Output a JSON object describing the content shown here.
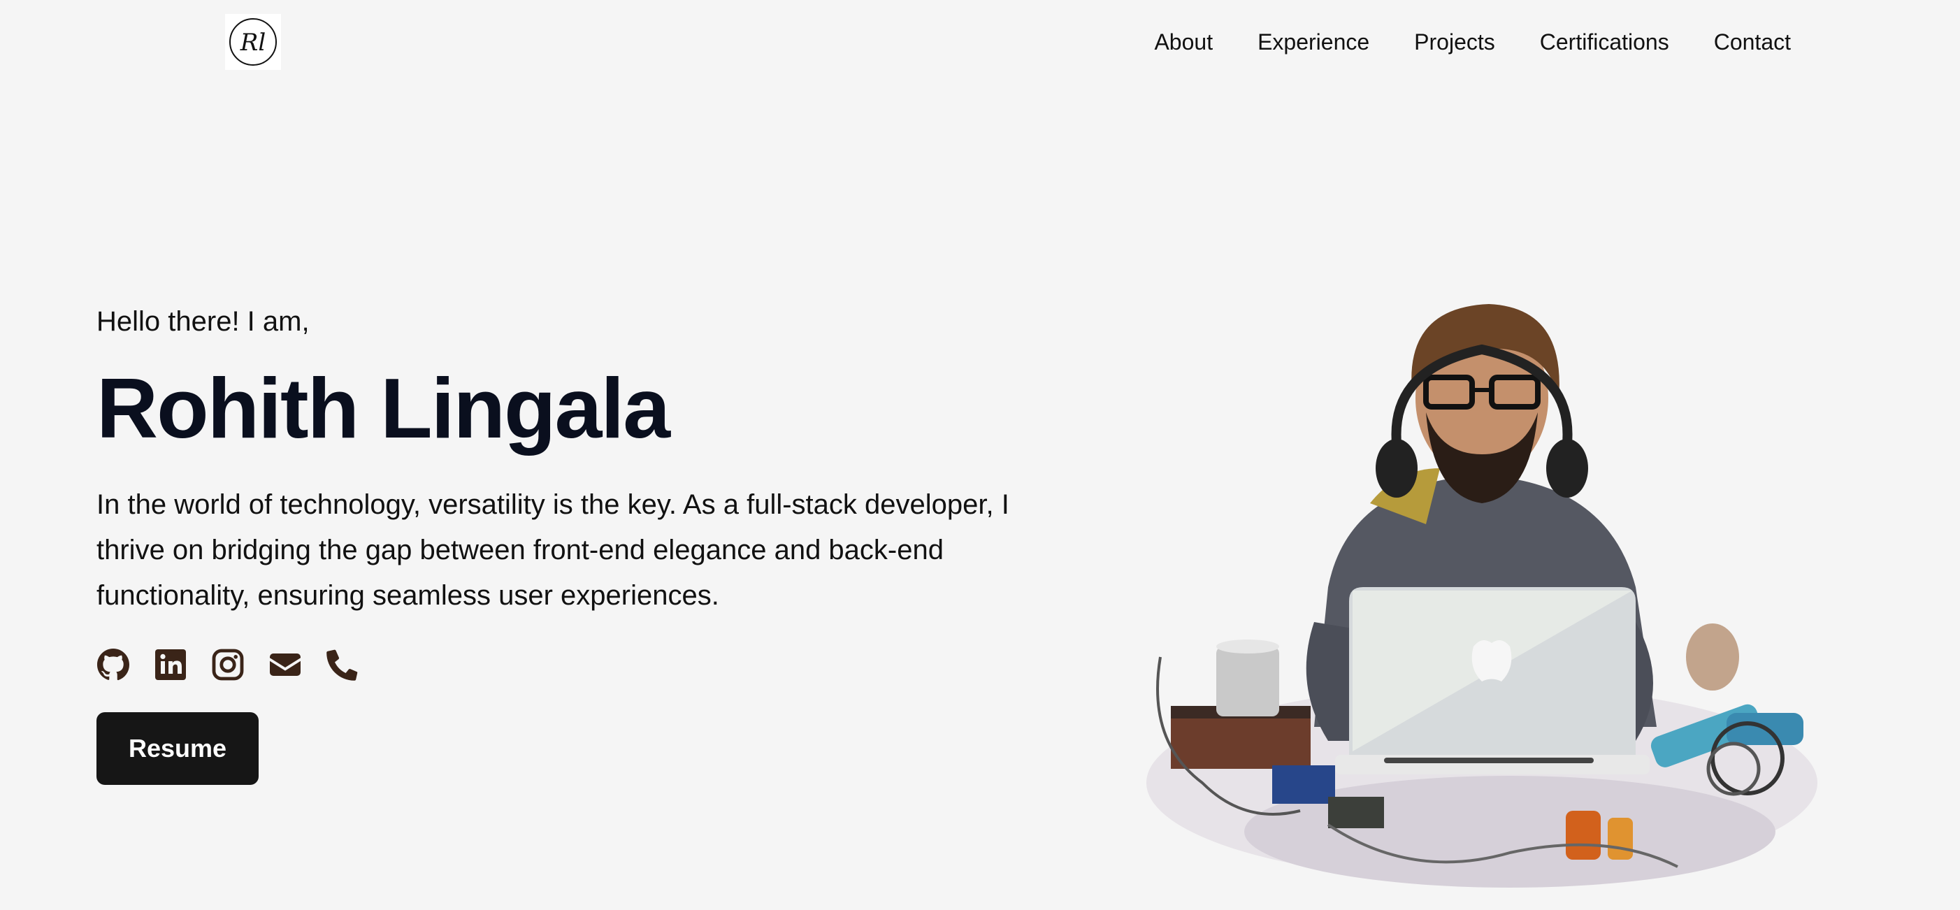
{
  "header": {
    "logo_monogram": "Rl",
    "nav": [
      {
        "label": "About"
      },
      {
        "label": "Experience"
      },
      {
        "label": "Projects"
      },
      {
        "label": "Certifications"
      },
      {
        "label": "Contact"
      }
    ]
  },
  "hero": {
    "greeting": "Hello there! I am,",
    "name": "Rohith Lingala",
    "tagline": "In the world of technology, versatility is the key. As a full-stack developer, I thrive on bridging the gap between front-end elegance and back-end functionality, ensuring seamless user experiences.",
    "socials": [
      {
        "icon": "github-icon"
      },
      {
        "icon": "linkedin-icon"
      },
      {
        "icon": "instagram-icon"
      },
      {
        "icon": "mail-icon"
      },
      {
        "icon": "phone-icon"
      }
    ],
    "resume_label": "Resume",
    "illustration": "developer-illustration"
  },
  "colors": {
    "background": "#f5f5f5",
    "text": "#0a0f1e",
    "icon": "#3a2418",
    "button": "#161616",
    "button_text": "#ffffff"
  }
}
